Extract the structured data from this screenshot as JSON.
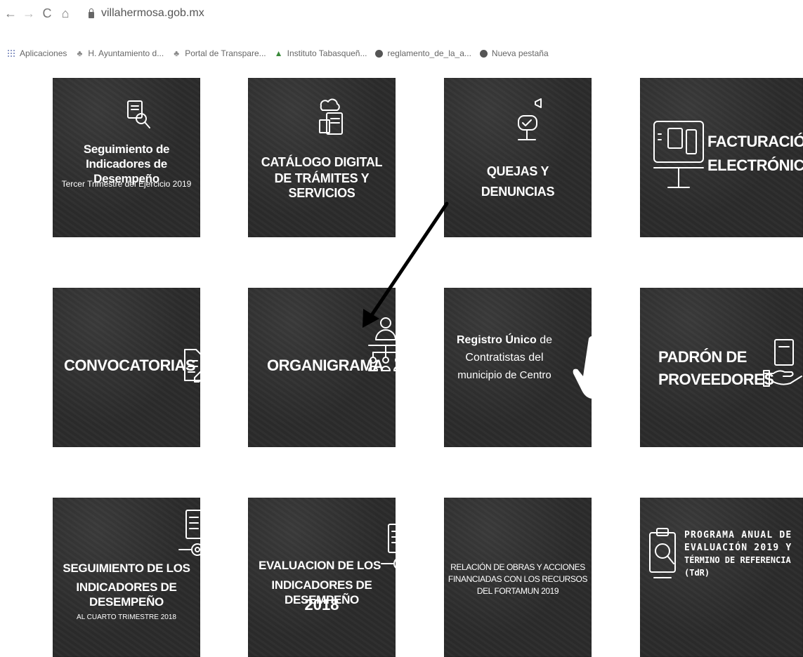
{
  "browser": {
    "nav": {
      "back": "←",
      "forward": "→",
      "reload": "C",
      "home": "⌂"
    },
    "url": "villahermosa.gob.mx",
    "bookmarks": [
      {
        "label": "Aplicaciones"
      },
      {
        "label": "H. Ayuntamiento d..."
      },
      {
        "label": "Portal de Transpare..."
      },
      {
        "label": "Instituto Tabasqueñ..."
      },
      {
        "label": "reglamento_de_la_a..."
      },
      {
        "label": "Nueva pestaña"
      }
    ]
  },
  "tiles": {
    "seguimiento": {
      "title_line1": "Seguimiento de",
      "title_line2": "Indicadores de Desempeño",
      "subtitle": "Tercer Trimestre del Ejercicio 2019"
    },
    "catalogo": {
      "line1": "CATÁLOGO DIGITAL",
      "line2": "DE TRÁMITES Y SERVICIOS"
    },
    "quejas": {
      "line1": "QUEJAS Y",
      "line2": "DENUNCIAS"
    },
    "facturacion": {
      "line1": "FACTURACIÓN",
      "line2": "ELECTRÓNICA"
    },
    "convocatorias": {
      "label": "CONVOCATORIAS"
    },
    "organigrama": {
      "label": "ORGANIGRAMA"
    },
    "registro": {
      "bold": "Registro Único",
      "rest1": " de",
      "line2": "Contratistas del",
      "line3": "municipio de Centro"
    },
    "padron": {
      "line1": "PADRÓN DE",
      "line2": "PROVEEDORES"
    },
    "seguimiento_cuarto": {
      "line1": "SEGUIMIENTO DE LOS",
      "line2": "INDICADORES DE DESEMPEÑO",
      "subtitle": "AL CUARTO TRIMESTRE 2018"
    },
    "evaluacion": {
      "line1": "EVALUACION DE LOS",
      "line2": "INDICADORES DE DESEMPEÑO",
      "year": "2018"
    },
    "relacion": {
      "line1": "RELACIÓN DE OBRAS Y ACCIONES",
      "line2": "FINANCIADAS CON LOS RECURSOS",
      "line3": "DEL FORTAMUN 2019"
    },
    "programa": {
      "line1": "PROGRAMA ANUAL DE",
      "line2": "EVALUACIÓN 2019 Y",
      "line3": "TÉRMINO DE REFERENCIA",
      "line4": "(TdR)"
    }
  }
}
